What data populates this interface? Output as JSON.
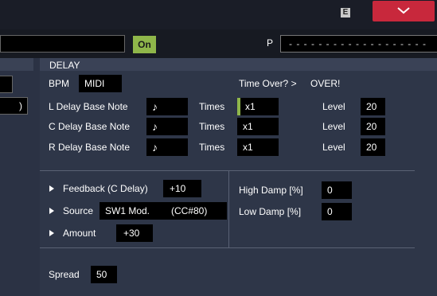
{
  "top_bar": {
    "e_label": "E"
  },
  "row2": {
    "on_label": "On",
    "p_label": "P",
    "p_field": "- - - - - - - - - - - - - - - - - - -"
  },
  "left": {
    "box2_value": ")"
  },
  "delay": {
    "title": "DELAY",
    "bpm_label": "BPM",
    "bpm_value": "MIDI",
    "time_over_label": "Time Over? >",
    "time_over_value": "OVER!",
    "rows": [
      {
        "label": "L Delay Base Note",
        "note": "♪",
        "times_label": "Times",
        "times_value": "x1",
        "level_label": "Level",
        "level_value": "20"
      },
      {
        "label": "C Delay Base Note",
        "note": "♪",
        "times_label": "Times",
        "times_value": "x1",
        "level_label": "Level",
        "level_value": "20"
      },
      {
        "label": "R Delay Base Note",
        "note": "♪",
        "times_label": "Times",
        "times_value": "x1",
        "level_label": "Level",
        "level_value": "20"
      }
    ],
    "feedback_label": "Feedback (C Delay)",
    "feedback_value": "+10",
    "source_label": "Source",
    "source_value": "SW1 Mod.",
    "source_cc": "(CC#80)",
    "amount_label": "Amount",
    "amount_value": "+30",
    "high_damp_label": "High Damp [%]",
    "high_damp_value": "0",
    "low_damp_label": "Low Damp [%]",
    "low_damp_value": "0",
    "spread_label": "Spread",
    "spread_value": "50"
  },
  "colors": {
    "accent_green": "#8fb64a",
    "close_red": "#c8283c",
    "panel": "#2e3648"
  }
}
